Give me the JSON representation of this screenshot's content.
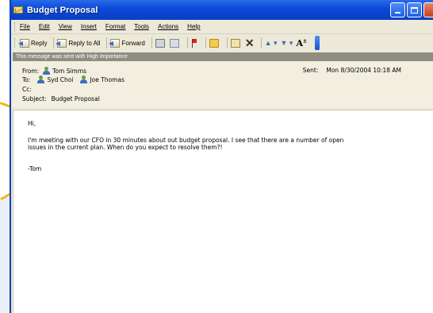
{
  "window": {
    "title": "Budget Proposal",
    "accent_color": "#0a48d6",
    "pointer_color": "#f6b418"
  },
  "menu": [
    {
      "label": "File"
    },
    {
      "label": "Edit"
    },
    {
      "label": "View"
    },
    {
      "label": "Insert"
    },
    {
      "label": "Format"
    },
    {
      "label": "Tools"
    },
    {
      "label": "Actions"
    },
    {
      "label": "Help"
    }
  ],
  "toolbar": {
    "reply_label": "Reply",
    "reply_all_label": "Reply to All",
    "forward_label": "Forward",
    "icons": [
      "print-icon",
      "move-icon",
      "flag-icon",
      "folder-icon",
      "address-book-icon",
      "delete-icon",
      "previous-item-icon",
      "next-item-icon",
      "font-size-icon"
    ]
  },
  "message": {
    "importance_banner": "This message was sent with High Importance",
    "from_label": "From:",
    "from": "Tom Simms",
    "to_label": "To:",
    "to": [
      "Syd Choi",
      "Joe Thomas"
    ],
    "cc_label": "Cc:",
    "cc": "",
    "subject_label": "Subject:",
    "subject": "Budget Proposal",
    "sent_label": "Sent:",
    "sent": "Mon 8/30/2004 10:18 AM",
    "body": {
      "greeting": "Hi,",
      "line1": "I'm meeting with our CFO in 30 minutes about out budget proposal. I see that there are a number of open",
      "line2": "issues in the current plan. When do you expect to resolve them?!",
      "signature": "-Tom"
    }
  }
}
